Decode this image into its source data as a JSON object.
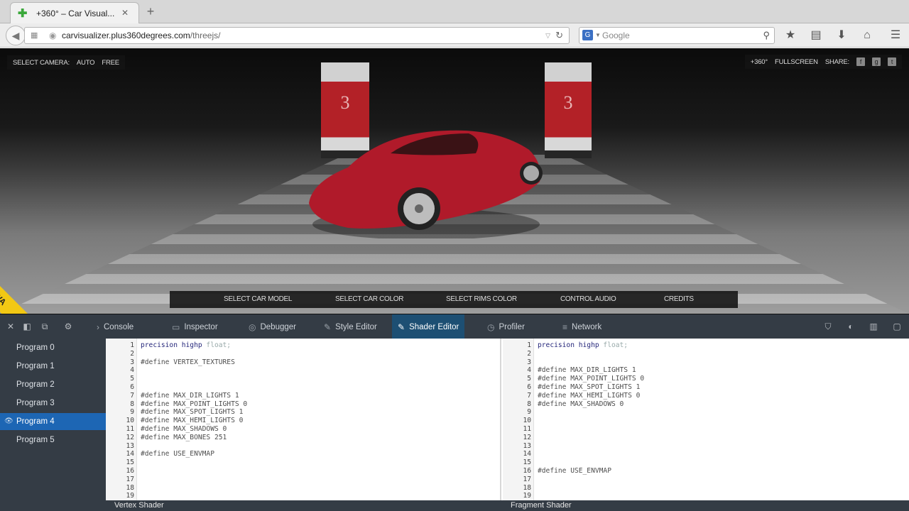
{
  "browser": {
    "tab_title": "+360° – Car Visual...",
    "new_tab": "+",
    "url_host": "carvisualizer.plus360degrees.com",
    "url_path": "/threejs/",
    "search_placeholder": "Google"
  },
  "scene": {
    "select_camera": "SELECT CAMERA:",
    "camera_auto": "AUTO",
    "camera_free": "FREE",
    "brand": "+360°",
    "fullscreen": "FULLSCREEN",
    "share": "SHARE:",
    "pillar_number": "3",
    "menu": [
      "SELECT CAR MODEL",
      "SELECT CAR COLOR",
      "SELECT RIMS COLOR",
      "CONTROL AUDIO",
      "CREDITS"
    ],
    "fwa": "FWA",
    "car_color": "#b01a2a"
  },
  "devtools": {
    "tabs": [
      "Console",
      "Inspector",
      "Debugger",
      "Style Editor",
      "Shader Editor",
      "Profiler",
      "Network"
    ],
    "active_tab": "Shader Editor",
    "accent": "#1d66b4"
  },
  "programs": [
    "Program 0",
    "Program 1",
    "Program 2",
    "Program 3",
    "Program 4",
    "Program 5"
  ],
  "selected_program": "Program 4",
  "vertex_shader": {
    "label": "Vertex Shader",
    "lines": [
      "precision highp float;",
      "",
      "#define VERTEX_TEXTURES",
      "",
      "",
      "",
      "#define MAX_DIR_LIGHTS 1",
      "#define MAX_POINT_LIGHTS 0",
      "#define MAX_SPOT_LIGHTS 1",
      "#define MAX_HEMI_LIGHTS 0",
      "#define MAX_SHADOWS 0",
      "#define MAX_BONES 251",
      "",
      "#define USE_ENVMAP",
      "",
      "",
      "",
      "",
      ""
    ]
  },
  "fragment_shader": {
    "label": "Fragment Shader",
    "lines": [
      "precision highp float;",
      "",
      "",
      "#define MAX_DIR_LIGHTS 1",
      "#define MAX_POINT_LIGHTS 0",
      "#define MAX_SPOT_LIGHTS 1",
      "#define MAX_HEMI_LIGHTS 0",
      "#define MAX_SHADOWS 0",
      "",
      "",
      "",
      "",
      "",
      "",
      "",
      "#define USE_ENVMAP",
      "",
      "",
      ""
    ]
  }
}
